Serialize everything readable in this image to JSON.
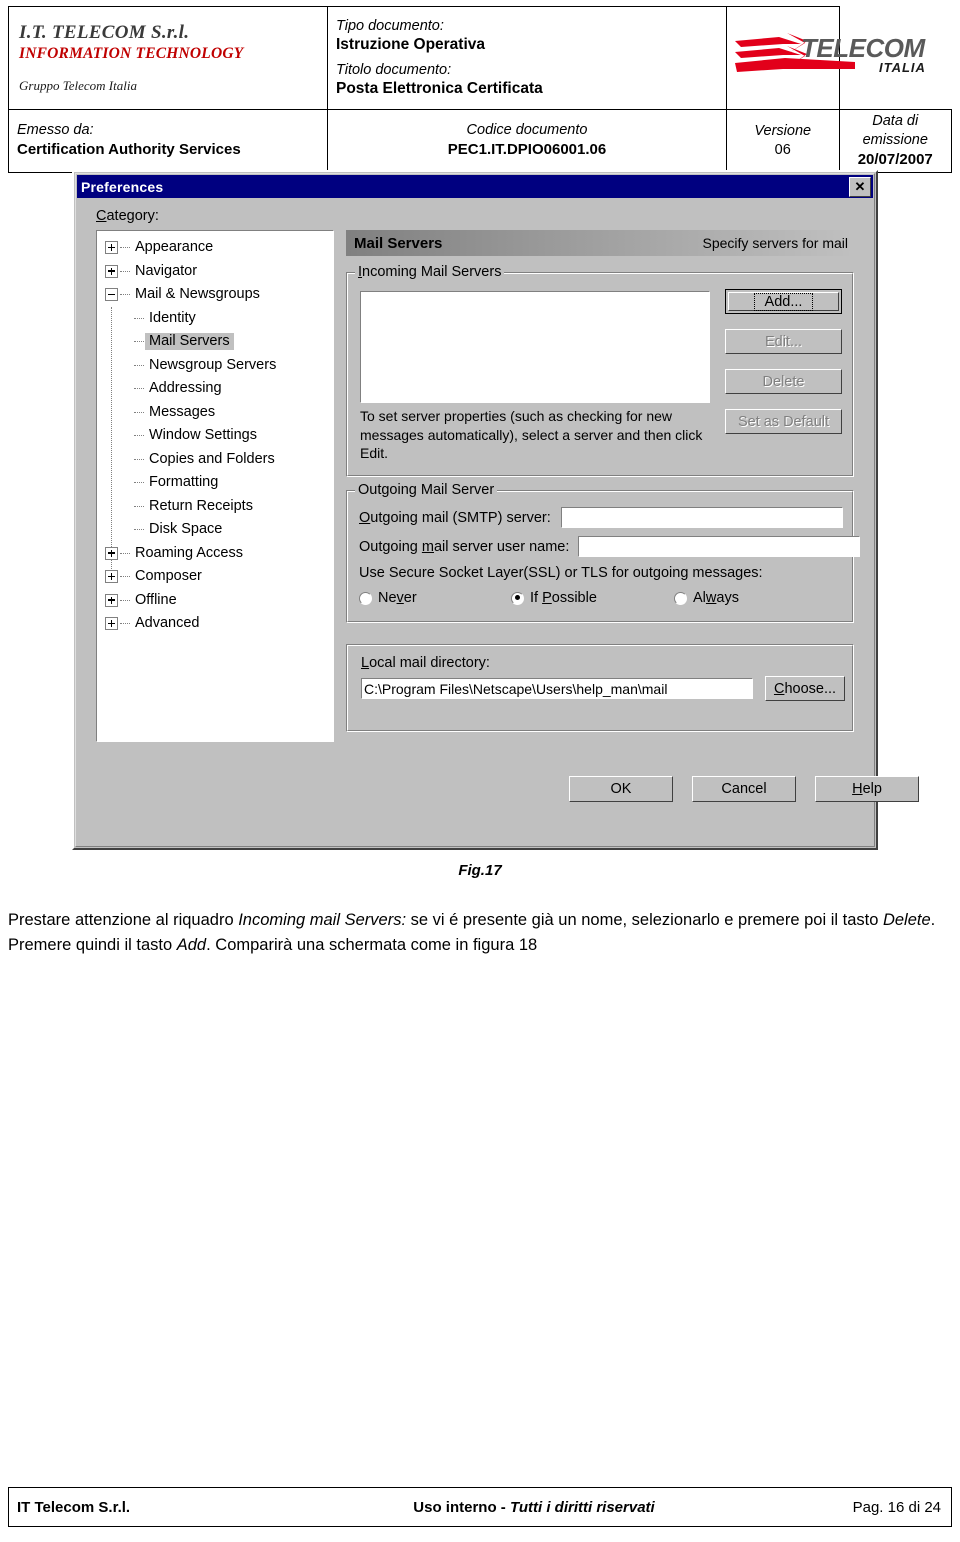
{
  "header": {
    "company": {
      "line1": "I.T. TELECOM S.r.l.",
      "line2": "INFORMATION TECHNOLOGY",
      "line3": "Gruppo Telecom Italia"
    },
    "doc": {
      "tipo_label": "Tipo documento:",
      "tipo_value": "Istruzione Operativa",
      "titolo_label": "Titolo documento:",
      "titolo_value": "Posta Elettronica Certificata"
    },
    "logo": {
      "brand": "TELECOM",
      "sub": "ITALIA",
      "red": "#e2001a",
      "grey": "#5a5a5a"
    },
    "row2": {
      "emesso_label": "Emesso da:",
      "emesso_value": "Certification Authority Services",
      "codice_label": "Codice documento",
      "codice_value": "PEC1.IT.DPIO06001.06",
      "versione_label": "Versione",
      "versione_value": "06",
      "data_label": "Data di emissione",
      "data_value": "20/07/2007"
    }
  },
  "dialog": {
    "title": "Preferences",
    "close_label": "✕",
    "category_label": "Category:",
    "tree": [
      {
        "label": "Appearance",
        "level": 0,
        "expander": "plus",
        "selected": false
      },
      {
        "label": "Navigator",
        "level": 0,
        "expander": "plus",
        "selected": false
      },
      {
        "label": "Mail & Newsgroups",
        "level": 0,
        "expander": "minus",
        "selected": false
      },
      {
        "label": "Identity",
        "level": 1,
        "expander": "none",
        "selected": false
      },
      {
        "label": "Mail Servers",
        "level": 1,
        "expander": "none",
        "selected": true
      },
      {
        "label": "Newsgroup Servers",
        "level": 1,
        "expander": "none",
        "selected": false
      },
      {
        "label": "Addressing",
        "level": 1,
        "expander": "none",
        "selected": false
      },
      {
        "label": "Messages",
        "level": 1,
        "expander": "none",
        "selected": false
      },
      {
        "label": "Window Settings",
        "level": 1,
        "expander": "none",
        "selected": false
      },
      {
        "label": "Copies and Folders",
        "level": 1,
        "expander": "none",
        "selected": false
      },
      {
        "label": "Formatting",
        "level": 1,
        "expander": "none",
        "selected": false
      },
      {
        "label": "Return Receipts",
        "level": 1,
        "expander": "none",
        "selected": false
      },
      {
        "label": "Disk Space",
        "level": 1,
        "expander": "none",
        "selected": false
      },
      {
        "label": "Roaming Access",
        "level": 0,
        "expander": "plus",
        "selected": false
      },
      {
        "label": "Composer",
        "level": 0,
        "expander": "plus",
        "selected": false
      },
      {
        "label": "Offline",
        "level": 0,
        "expander": "plus",
        "selected": false
      },
      {
        "label": "Advanced",
        "level": 0,
        "expander": "plus",
        "selected": false
      }
    ],
    "panel": {
      "title": "Mail Servers",
      "subtitle": "Specify servers for mail"
    },
    "incoming": {
      "legend": "Incoming Mail Servers",
      "list_items": [],
      "hint": "To set server properties (such as checking for new messages automatically), select a server and then click Edit.",
      "buttons": [
        {
          "label": "Add...",
          "disabled": false,
          "default": true
        },
        {
          "label": "Edit...",
          "disabled": true,
          "default": false
        },
        {
          "label": "Delete",
          "disabled": true,
          "default": false
        },
        {
          "label": "Set as Default",
          "disabled": true,
          "default": false
        }
      ]
    },
    "outgoing": {
      "legend": "Outgoing Mail Server",
      "smtp_label": "Outgoing mail (SMTP) server:",
      "smtp_value": "",
      "user_label": "Outgoing mail server user name:",
      "user_value": "",
      "ssl_label": "Use Secure Socket Layer(SSL) or TLS for outgoing messages:",
      "ssl_options": [
        {
          "label": "Never",
          "checked": false
        },
        {
          "label": "If Possible",
          "checked": true
        },
        {
          "label": "Always",
          "checked": false
        }
      ]
    },
    "local_dir": {
      "label": "Local mail directory:",
      "value": "C:\\Program Files\\Netscape\\Users\\help_man\\mail",
      "choose_label": "Choose..."
    },
    "bottom_buttons": [
      {
        "label": "OK"
      },
      {
        "label": "Cancel"
      },
      {
        "label": "Help"
      }
    ]
  },
  "figure": {
    "caption": "Fig.17"
  },
  "body": {
    "p1_part1": "Prestare attenzione al riquadro ",
    "p1_em1": "Incoming mail Servers:",
    "p1_part2": " se vi é presente già un nome, selezionarlo e premere poi il tasto ",
    "p1_em2": "Delete",
    "p1_part3": ".",
    "p2_part1": "Premere quindi il tasto ",
    "p2_em1": "Add",
    "p2_part2": ". Comparirà una schermata come in figura 18"
  },
  "footer": {
    "left": "IT Telecom S.r.l.",
    "center_plain": "Uso interno - ",
    "center_em": "Tutti i diritti riservati",
    "right": "Pag. 16 di 24"
  }
}
